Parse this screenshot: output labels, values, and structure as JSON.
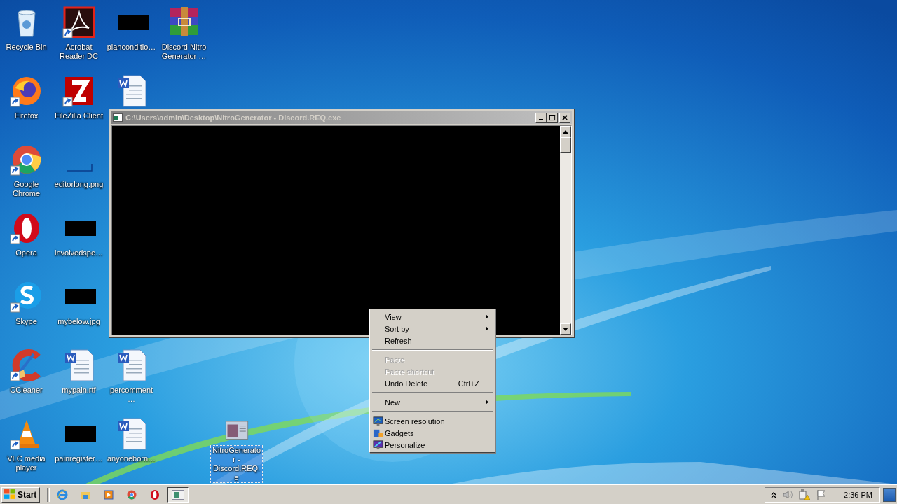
{
  "desktop_icons": [
    {
      "label": "Recycle Bin",
      "kind": "recycle",
      "shortcut": false,
      "selected": false
    },
    {
      "label": "Firefox",
      "kind": "firefox",
      "shortcut": true,
      "selected": false
    },
    {
      "label": "Google Chrome",
      "kind": "chrome",
      "shortcut": true,
      "selected": false
    },
    {
      "label": "Opera",
      "kind": "opera",
      "shortcut": true,
      "selected": false
    },
    {
      "label": "Skype",
      "kind": "skype",
      "shortcut": true,
      "selected": false
    },
    {
      "label": "CCleaner",
      "kind": "ccleaner",
      "shortcut": true,
      "selected": false
    },
    {
      "label": "VLC media player",
      "kind": "vlc",
      "shortcut": true,
      "selected": false
    },
    {
      "label": "Acrobat Reader DC",
      "kind": "acrobat",
      "shortcut": true,
      "selected": false
    },
    {
      "label": "FileZilla Client",
      "kind": "filezilla",
      "shortcut": true,
      "selected": false
    },
    {
      "label": "editorlong.png",
      "kind": "thin",
      "shortcut": false,
      "selected": false
    },
    {
      "label": "involvedspe…",
      "kind": "black",
      "shortcut": false,
      "selected": false
    },
    {
      "label": "mybelow.jpg",
      "kind": "black",
      "shortcut": false,
      "selected": false
    },
    {
      "label": "mypain.rtf",
      "kind": "word",
      "shortcut": false,
      "selected": false
    },
    {
      "label": "painregister…",
      "kind": "black",
      "shortcut": false,
      "selected": false
    },
    {
      "label": "planconditio…",
      "kind": "black",
      "shortcut": false,
      "selected": false
    },
    {
      "kind": "word",
      "shortcut": false,
      "selected": false
    },
    {
      "label": "percomment…",
      "kind": "word",
      "shortcut": false,
      "selected": false
    },
    {
      "label": "anyoneborn…",
      "kind": "word",
      "shortcut": false,
      "selected": false
    },
    {
      "label": "Discord Nitro Generator …",
      "kind": "winrar",
      "shortcut": false,
      "selected": false
    },
    {
      "label": "NitroGenerator - Discord.REQ.e",
      "kind": "app",
      "shortcut": false,
      "selected": true
    }
  ],
  "console_window": {
    "title": "C:\\Users\\admin\\Desktop\\NitroGenerator - Discord.REQ.exe"
  },
  "context_menu": [
    {
      "kind": "item",
      "label": "View",
      "submenu": true,
      "disabled": false
    },
    {
      "kind": "item",
      "label": "Sort by",
      "submenu": true,
      "disabled": false
    },
    {
      "kind": "item",
      "label": "Refresh",
      "submenu": false,
      "disabled": false
    },
    {
      "kind": "separator"
    },
    {
      "kind": "item",
      "label": "Paste",
      "submenu": false,
      "disabled": true
    },
    {
      "kind": "item",
      "label": "Paste shortcut",
      "submenu": false,
      "disabled": true
    },
    {
      "kind": "item",
      "label": "Undo Delete",
      "shortcut": "Ctrl+Z",
      "submenu": false,
      "disabled": false
    },
    {
      "kind": "separator"
    },
    {
      "kind": "item",
      "label": "New",
      "submenu": true,
      "disabled": false
    },
    {
      "kind": "separator"
    },
    {
      "kind": "item",
      "label": "Screen resolution",
      "submenu": false,
      "disabled": false
    },
    {
      "kind": "item",
      "label": "Gadgets",
      "submenu": false,
      "disabled": false
    },
    {
      "kind": "item",
      "label": "Personalize",
      "submenu": false,
      "disabled": false
    }
  ],
  "taskbar": {
    "start": "Start",
    "window_buttons": [
      {
        "kind": "app",
        "selected": true
      }
    ],
    "clock": "2:36 PM"
  }
}
